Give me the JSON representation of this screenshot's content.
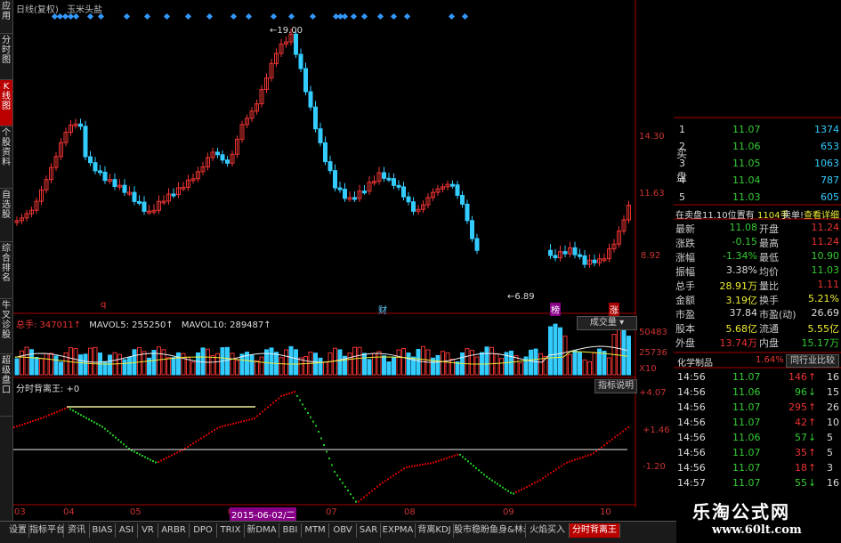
{
  "header": {
    "title": "日线(复权)",
    "subtitle": "玉米头盐"
  },
  "left_nav": [
    {
      "label": "应用",
      "active": false
    },
    {
      "label": "分时图",
      "active": false
    },
    {
      "label": "K线图",
      "active": true
    },
    {
      "label": "个股资料",
      "active": false
    },
    {
      "label": "自选股",
      "active": false
    },
    {
      "label": "综合排名",
      "active": false
    },
    {
      "label": "牛叉诊股",
      "active": false
    },
    {
      "label": "超级盘口",
      "active": false
    }
  ],
  "price_chart": {
    "axis_labels": [
      "14.30",
      "11.63",
      "8.92"
    ],
    "high_marker": "19.00",
    "low_marker": "6.89",
    "event_markers": [
      "q",
      "财",
      "榜",
      "涨"
    ]
  },
  "volume_panel": {
    "label_total": "总手: 347011↑",
    "label_ma5": "MAVOL5: 255250↑",
    "label_ma10": "MAVOL10: 289487↑",
    "dropdown": "成交量",
    "axis_labels": [
      "50483",
      "25736",
      "X10"
    ]
  },
  "indicator_panel": {
    "title": "分时背离王: +0",
    "help_button": "指标说明",
    "axis_labels": [
      "+4.07",
      "+1.46",
      "-1.20"
    ]
  },
  "date_axis": {
    "labels": [
      "03",
      "04",
      "05",
      "06",
      "07",
      "08",
      "09",
      "10"
    ],
    "cursor_date": "2015-06-02/二"
  },
  "order_book": {
    "sell_label": "买盘",
    "rows": [
      {
        "level": "1",
        "price": "11.07",
        "volume": "1374"
      },
      {
        "level": "2",
        "price": "11.06",
        "volume": "653"
      },
      {
        "level": "3",
        "price": "11.05",
        "volume": "1063"
      },
      {
        "level": "4",
        "price": "11.04",
        "volume": "787"
      },
      {
        "level": "5",
        "price": "11.03",
        "volume": "605"
      }
    ],
    "note": "在卖盘11.10位置有",
    "note_qty": "1104手",
    "note_action1": "卖单!",
    "note_action2": "查看详细"
  },
  "quote": [
    {
      "l1": "最新",
      "v1": "11.08",
      "c1": "g",
      "l2": "开盘",
      "v2": "11.24",
      "c2": "r"
    },
    {
      "l1": "涨跌",
      "v1": "-0.15",
      "c1": "g",
      "l2": "最高",
      "v2": "11.24",
      "c2": "r"
    },
    {
      "l1": "涨幅",
      "v1": "-1.34%",
      "c1": "g",
      "l2": "最低",
      "v2": "10.90",
      "c2": "g"
    },
    {
      "l1": "振幅",
      "v1": "3.38%",
      "c1": "w",
      "l2": "均价",
      "v2": "11.03",
      "c2": "g"
    },
    {
      "l1": "总手",
      "v1": "28.91万",
      "c1": "y",
      "l2": "量比",
      "v2": "1.11",
      "c2": "r"
    },
    {
      "l1": "金额",
      "v1": "3.19亿",
      "c1": "y",
      "l2": "换手",
      "v2": "5.21%",
      "c2": "y"
    },
    {
      "l1": "市盈",
      "v1": "37.84",
      "c1": "w",
      "l2": "市盈(动)",
      "v2": "26.69",
      "c2": "w"
    },
    {
      "l1": "股本",
      "v1": "5.68亿",
      "c1": "y",
      "l2": "流通",
      "v2": "5.55亿",
      "c2": "y"
    },
    {
      "l1": "外盘",
      "v1": "13.74万",
      "c1": "r",
      "l2": "内盘",
      "v2": "15.17万",
      "c2": "g"
    }
  ],
  "industry": {
    "name": "化学制品",
    "change": "1.64%",
    "button": "同行业比较"
  },
  "ticks": [
    {
      "time": "14:56",
      "price": "11.07",
      "vol": "146",
      "dir": "up",
      "n": "16"
    },
    {
      "time": "14:56",
      "price": "11.06",
      "vol": "96",
      "dir": "down",
      "n": "15"
    },
    {
      "time": "14:56",
      "price": "11.07",
      "vol": "295",
      "dir": "up",
      "n": "26"
    },
    {
      "time": "14:56",
      "price": "11.07",
      "vol": "42",
      "dir": "up",
      "n": "10"
    },
    {
      "time": "14:56",
      "price": "11.06",
      "vol": "57",
      "dir": "down",
      "n": "5"
    },
    {
      "time": "14:56",
      "price": "11.07",
      "vol": "35",
      "dir": "up",
      "n": "5"
    },
    {
      "time": "14:56",
      "price": "11.07",
      "vol": "18",
      "dir": "up",
      "n": "3"
    },
    {
      "time": "14:57",
      "price": "11.07",
      "vol": "55",
      "dir": "down",
      "n": "16"
    }
  ],
  "bottom_tabs": [
    {
      "label": "设置",
      "active": false
    },
    {
      "label": "指标平台",
      "active": false
    },
    {
      "label": "资讯",
      "active": false
    },
    {
      "label": "BIAS",
      "active": false
    },
    {
      "label": "ASI",
      "active": false
    },
    {
      "label": "VR",
      "active": false
    },
    {
      "label": "ARBR",
      "active": false
    },
    {
      "label": "DPO",
      "active": false
    },
    {
      "label": "TRIX",
      "active": false
    },
    {
      "label": "新DMA",
      "active": false
    },
    {
      "label": "BBI",
      "active": false
    },
    {
      "label": "MTM",
      "active": false
    },
    {
      "label": "OBV",
      "active": false
    },
    {
      "label": "SAR",
      "active": false
    },
    {
      "label": "EXPMA",
      "active": false
    },
    {
      "label": "背离KDJ",
      "active": false
    },
    {
      "label": "股市稳盼鱼身&林永",
      "active": false
    },
    {
      "label": "火焰买入",
      "active": false
    },
    {
      "label": "分时背离王",
      "active": true
    }
  ],
  "watermark": {
    "line1": "乐淘公式网",
    "line2": "www.60lt.com"
  },
  "colors": {
    "up": "#e33",
    "down": "#3cf",
    "green": "#3c3",
    "yellow": "#ee3",
    "indicator_up": "#c00",
    "indicator_down": "#2c2"
  }
}
